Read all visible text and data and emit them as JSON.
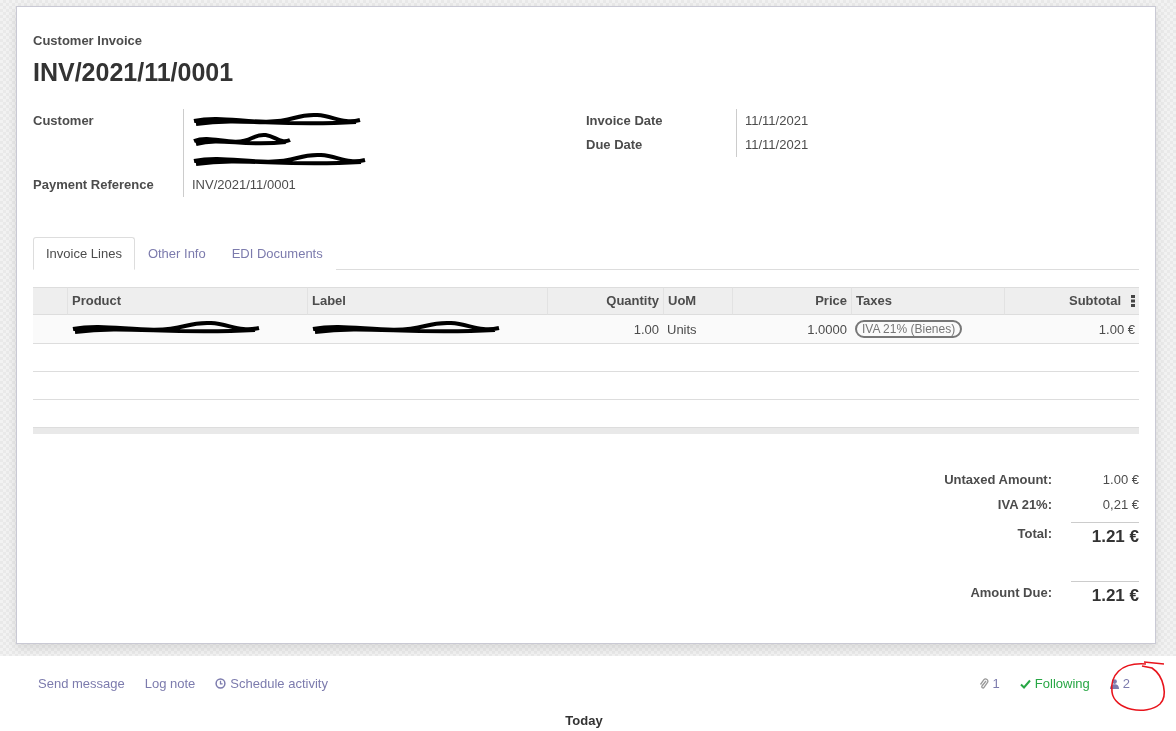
{
  "header": {
    "caption": "Customer Invoice",
    "number": "INV/2021/11/0001"
  },
  "fields_left": [
    {
      "label": "Customer",
      "kind": "redacted"
    },
    {
      "label": "Payment Reference",
      "kind": "text",
      "value": "INV/2021/11/0001"
    }
  ],
  "fields_right": [
    {
      "label": "Invoice Date",
      "value": "11/11/2021"
    },
    {
      "label": "Due Date",
      "value": "11/11/2021"
    }
  ],
  "tabs": [
    {
      "label": "Invoice Lines",
      "selected": true
    },
    {
      "label": "Other Info",
      "selected": false
    },
    {
      "label": "EDI Documents",
      "selected": false
    }
  ],
  "table": {
    "columns": [
      {
        "label": "Product",
        "kind": "text"
      },
      {
        "label": "Label",
        "kind": "text"
      },
      {
        "label": "Quantity",
        "kind": "numeric"
      },
      {
        "label": "UoM",
        "kind": "text"
      },
      {
        "label": "Price",
        "kind": "numeric"
      },
      {
        "label": "Taxes",
        "kind": "text"
      },
      {
        "label": "Subtotal",
        "kind": "numeric"
      }
    ],
    "rows": [
      [
        {
          "kind": "redacted"
        },
        {
          "kind": "redacted"
        },
        {
          "kind": "text",
          "text": "1.00"
        },
        {
          "kind": "text",
          "text": "Units"
        },
        {
          "kind": "text",
          "text": "1.0000"
        },
        {
          "kind": "tag",
          "text": "IVA 21% (Bienes)"
        },
        {
          "kind": "text",
          "text": "1.00 €"
        }
      ]
    ]
  },
  "totals": [
    {
      "label": "Untaxed Amount:",
      "value": "1.00 €",
      "kind": "plain"
    },
    {
      "label": "IVA 21%:",
      "value": "0,21 €",
      "kind": "plain"
    },
    {
      "label": "Total:",
      "value": "1.21 €",
      "kind": "emphasis"
    },
    {
      "label": "Amount Due:",
      "value": "1.21 €",
      "kind": "emphasis"
    }
  ],
  "chatter": {
    "actions": [
      {
        "label": "Send message",
        "kind": "link"
      },
      {
        "label": "Log note",
        "kind": "link"
      },
      {
        "label": "Schedule activity",
        "kind": "activity"
      }
    ],
    "attachments": "1",
    "following": "Following",
    "followers": "2",
    "today": "Today"
  }
}
